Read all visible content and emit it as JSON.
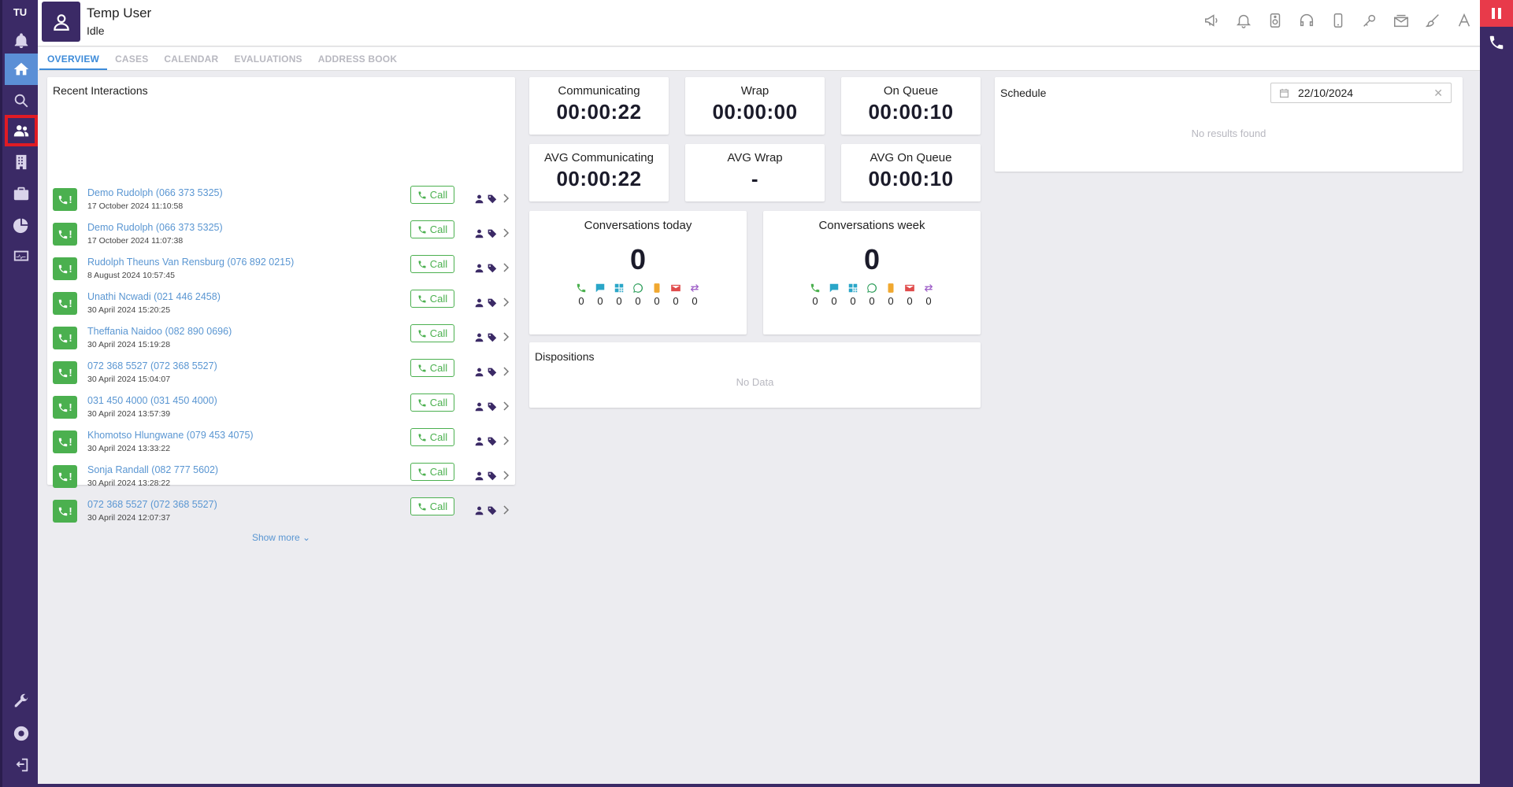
{
  "user": {
    "initials": "TU",
    "name": "Temp User",
    "status": "Idle"
  },
  "tabs": [
    {
      "label": "OVERVIEW",
      "active": true
    },
    {
      "label": "CASES"
    },
    {
      "label": "CALENDAR"
    },
    {
      "label": "EVALUATIONS"
    },
    {
      "label": "ADDRESS BOOK"
    }
  ],
  "recent": {
    "title": "Recent Interactions",
    "call_label": "Call",
    "badge_label": "!",
    "show_more": "Show more",
    "items": [
      {
        "name": "Demo Rudolph (066 373 5325)",
        "date": "17 October 2024 11:10:58"
      },
      {
        "name": "Demo Rudolph (066 373 5325)",
        "date": "17 October 2024 11:07:38"
      },
      {
        "name": "Rudolph Theuns Van Rensburg (076 892 0215)",
        "date": "8 August 2024 10:57:45"
      },
      {
        "name": "Unathi Ncwadi (021 446 2458)",
        "date": "30 April 2024 15:20:25"
      },
      {
        "name": "Theffania Naidoo (082 890 0696)",
        "date": "30 April 2024 15:19:28"
      },
      {
        "name": "072 368 5527 (072 368 5527)",
        "date": "30 April 2024 15:04:07"
      },
      {
        "name": "031 450 4000 (031 450 4000)",
        "date": "30 April 2024 13:57:39"
      },
      {
        "name": "Khomotso Hlungwane (079 453 4075)",
        "date": "30 April 2024 13:33:22"
      },
      {
        "name": "Sonja Randall (082 777 5602)",
        "date": "30 April 2024 13:28:22"
      },
      {
        "name": "072 368 5527 (072 368 5527)",
        "date": "30 April 2024 12:07:37"
      }
    ]
  },
  "stats": {
    "communicating": {
      "label": "Communicating",
      "value": "00:00:22"
    },
    "wrap": {
      "label": "Wrap",
      "value": "00:00:00"
    },
    "on_queue": {
      "label": "On Queue",
      "value": "00:00:10"
    },
    "avg_communicating": {
      "label": "AVG Communicating",
      "value": "00:00:22"
    },
    "avg_wrap": {
      "label": "AVG Wrap",
      "value": "-"
    },
    "avg_on_queue": {
      "label": "AVG On Queue",
      "value": "00:00:10"
    }
  },
  "conversations_today": {
    "label": "Conversations today",
    "total": "0",
    "counts": [
      "0",
      "0",
      "0",
      "0",
      "0",
      "0",
      "0"
    ]
  },
  "conversations_week": {
    "label": "Conversations week",
    "total": "0",
    "counts": [
      "0",
      "0",
      "0",
      "0",
      "0",
      "0",
      "0"
    ]
  },
  "channel_icons": [
    {
      "name": "phone-icon",
      "color": "#4bb04f"
    },
    {
      "name": "chat-icon",
      "color": "#2aa6c8"
    },
    {
      "name": "qr-icon",
      "color": "#2aa6c8"
    },
    {
      "name": "whatsapp-icon",
      "color": "#2e9e5b"
    },
    {
      "name": "sms-icon",
      "color": "#f0a830"
    },
    {
      "name": "email-icon",
      "color": "#e04c4c"
    },
    {
      "name": "callback-icon",
      "color": "#9b59c6"
    }
  ],
  "dispositions": {
    "title": "Dispositions",
    "empty": "No Data"
  },
  "schedule": {
    "title": "Schedule",
    "date": "22/10/2024",
    "empty": "No results found"
  },
  "colors": {
    "nav_bg": "#3b2a66",
    "accent": "#3d8bd9",
    "green": "#4bb04f",
    "highlight": "#e01b24"
  }
}
